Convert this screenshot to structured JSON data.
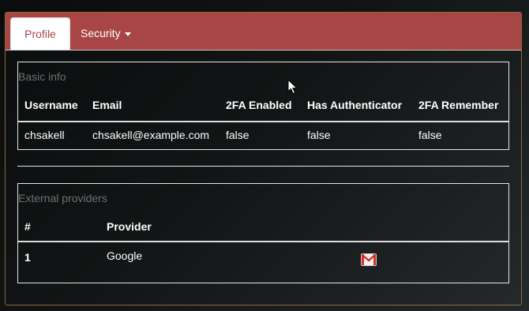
{
  "tabs": {
    "profile": "Profile",
    "security": "Security"
  },
  "basic_info": {
    "caption": "Basic info",
    "columns": [
      "Username",
      "Email",
      "2FA Enabled",
      "Has Authenticator",
      "2FA Remember"
    ],
    "row": [
      "chsakell",
      "chsakell@example.com",
      "false",
      "false",
      "false"
    ]
  },
  "external_providers": {
    "caption": "External providers",
    "columns": [
      "#",
      "Provider"
    ],
    "row": [
      "1",
      "Google"
    ],
    "row_icon": "gmail-icon"
  },
  "colors": {
    "tab_bar": "#a84646",
    "active_tab_text": "#a84646",
    "caption_text": "#6f6f6f",
    "table_text": "#ffffff"
  }
}
